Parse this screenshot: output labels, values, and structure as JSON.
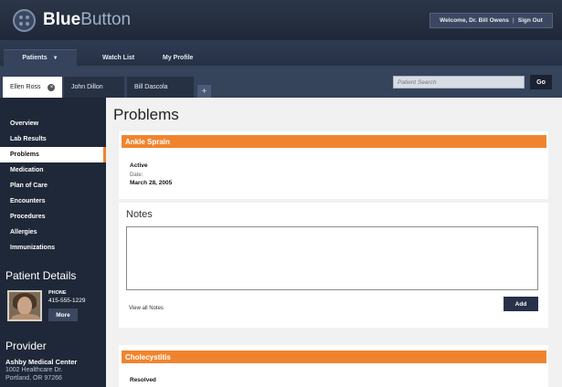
{
  "header": {
    "logo": {
      "bold": "Blue",
      "light": "Button"
    },
    "welcome": "Welcome, Dr. Bill Owens",
    "separator": "|",
    "sign_out": "Sign Out"
  },
  "nav": {
    "patients": "Patients",
    "patients_arrow": "▼",
    "watch_list": "Watch List",
    "my_profile": "My Profile"
  },
  "tabs": [
    {
      "label": "Ellen Ross",
      "close": "×"
    },
    {
      "label": "John Dillon"
    },
    {
      "label": "Bill Dascola"
    }
  ],
  "tab_add": "+",
  "search": {
    "placeholder": "Patient Search",
    "button": "Go"
  },
  "sidebar": {
    "items": [
      {
        "label": "Overview"
      },
      {
        "label": "Lab Results"
      },
      {
        "label": "Problems",
        "active": true
      },
      {
        "label": "Medication"
      },
      {
        "label": "Plan of Care"
      },
      {
        "label": "Encounters"
      },
      {
        "label": "Procedures"
      },
      {
        "label": "Allergies"
      },
      {
        "label": "Immunizations"
      }
    ],
    "patient_details": {
      "heading": "Patient Details",
      "phone_label": "PHONE",
      "phone": "415-555-1229",
      "more": "More"
    },
    "provider": {
      "heading": "Provider",
      "name": "Ashby Medical Center",
      "address1": "1002 Healthcare Dr.",
      "address2": "Portland, OR 97266"
    }
  },
  "main": {
    "title": "Problems",
    "problems": [
      {
        "name": "Ankle Sprain",
        "status": "Active",
        "date_label": "Date:",
        "date": "March 28, 2005"
      },
      {
        "name": "Cholecystitis",
        "status": "Resolved"
      }
    ],
    "notes": {
      "title": "Notes",
      "value": "",
      "view_all": "View all Notes",
      "add": "Add"
    }
  },
  "colors": {
    "header": "#222c3d",
    "sidebar": "#1f2838",
    "accent_orange": "#f0842e",
    "button_dark": "#27324a"
  }
}
